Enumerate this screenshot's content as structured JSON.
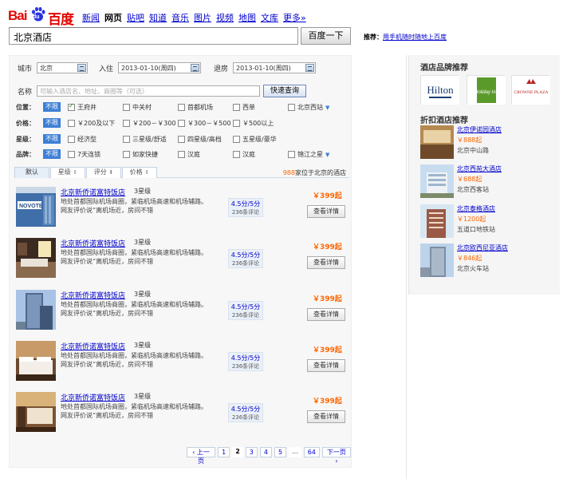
{
  "header": {
    "logo_text_left": "Bai",
    "logo_text_paw": "du",
    "logo_text_right": "百度",
    "nav": [
      "新闻",
      "网页",
      "贴吧",
      "知道",
      "音乐",
      "图片",
      "视频",
      "地图",
      "文库",
      "更多»"
    ],
    "nav_active_index": 1,
    "search_value": "北京酒店",
    "search_button": "百度一下",
    "promo_label": "推荐：",
    "promo_link": "用手机随时随地上百度"
  },
  "filters": {
    "city_label": "城市",
    "city_value": "北京",
    "checkin_label": "入住",
    "checkin_value": "2013-01-10(周四)",
    "checkout_label": "退房",
    "checkout_value": "2013-01-10(周四)",
    "name_label": "名称",
    "name_placeholder": "可输入酒店名、地址、商圈等（可选）",
    "quick_button": "快速查询",
    "all_label": "不限",
    "more_label": "▼",
    "location": {
      "label": "位置：",
      "options": [
        "王府井",
        "中关村",
        "首都机场",
        "西单",
        "北京西站"
      ],
      "checked": [
        true,
        false,
        false,
        false,
        false
      ]
    },
    "price": {
      "label": "价格：",
      "options": [
        "￥200及以下",
        "￥200－￥300",
        "￥300－￥500",
        "￥500以上"
      ]
    },
    "stars": {
      "label": "星级：",
      "options": [
        "经济型",
        "三星级/舒适",
        "四星级/高档",
        "五星级/豪华"
      ]
    },
    "brand": {
      "label": "品牌：",
      "options": [
        "7天连锁",
        "如家快捷",
        "汉庭",
        "汉庭",
        "锦江之星"
      ]
    }
  },
  "sort": {
    "tabs": [
      "默认",
      "星级",
      "评分",
      "价格"
    ],
    "tab_arrows": [
      "",
      "⇕",
      "⬇",
      "⇕"
    ],
    "count": "988",
    "count_suffix": "家位于北京的酒店"
  },
  "hotels": [
    {
      "name": "北京新侨诺富特饭店",
      "star": "3星级",
      "desc": "地处首都国际机场商圈，紧临机场高速和机场辅路。网友评价说“离机场近，房间不错",
      "score": "4.5分/5分",
      "reviews": "236条评论",
      "price": "￥399起",
      "button": "查看详情"
    },
    {
      "name": "北京新侨诺富特饭店",
      "star": "3星级",
      "desc": "地处首都国际机场商圈，紧临机场高速和机场辅路。网友评价说“离机场近，房间不错",
      "score": "4.5分/5分",
      "reviews": "236条评论",
      "price": "￥399起",
      "button": "查看详情"
    },
    {
      "name": "北京新侨诺富特饭店",
      "star": "3星级",
      "desc": "地处首都国际机场商圈，紧临机场高速和机场辅路。网友评价说“离机场近，房间不错",
      "score": "4.5分/5分",
      "reviews": "236条评论",
      "price": "￥399起",
      "button": "查看详情"
    },
    {
      "name": "北京新侨诺富特饭店",
      "star": "3星级",
      "desc": "地处首都国际机场商圈，紧临机场高速和机场辅路。网友评价说“离机场近，房间不错",
      "score": "4.5分/5分",
      "reviews": "236条评论",
      "price": "￥399起",
      "button": "查看详情"
    },
    {
      "name": "北京新侨诺富特饭店",
      "star": "3星级",
      "desc": "地处首都国际机场商圈，紧临机场高速和机场辅路。网友评价说“离机场近，房间不错",
      "score": "4.5分/5分",
      "reviews": "236条评论",
      "price": "￥399起",
      "button": "查看详情"
    }
  ],
  "pager": {
    "prev": "上一页",
    "pages": [
      "1",
      "2",
      "3",
      "4",
      "5",
      "...",
      "64"
    ],
    "current": "2",
    "next": "下一页"
  },
  "sidebar": {
    "brand_title": "酒店品牌推荐",
    "brands": [
      "Hilton",
      "Holiday Inn",
      "CROWNE PLAZA"
    ],
    "discount_title": "折扣酒店推荐",
    "hotels": [
      {
        "name": "北京伊诺园酒店",
        "price": "￥888起",
        "loc": "北京中山路"
      },
      {
        "name": "北京西苑大酒店",
        "price": "￥688起",
        "loc": "北京西客站"
      },
      {
        "name": "北京泰格酒店",
        "price": "￥1200起",
        "loc": "五道口地铁站"
      },
      {
        "name": "北京欧西尼亚酒店",
        "price": "￥846起",
        "loc": "北京火车站"
      }
    ]
  },
  "colors": {
    "brand_red": "#e10601",
    "link_blue": "#0000cc",
    "price_orange": "#ff6600",
    "chip_blue": "#3d7fd6"
  }
}
